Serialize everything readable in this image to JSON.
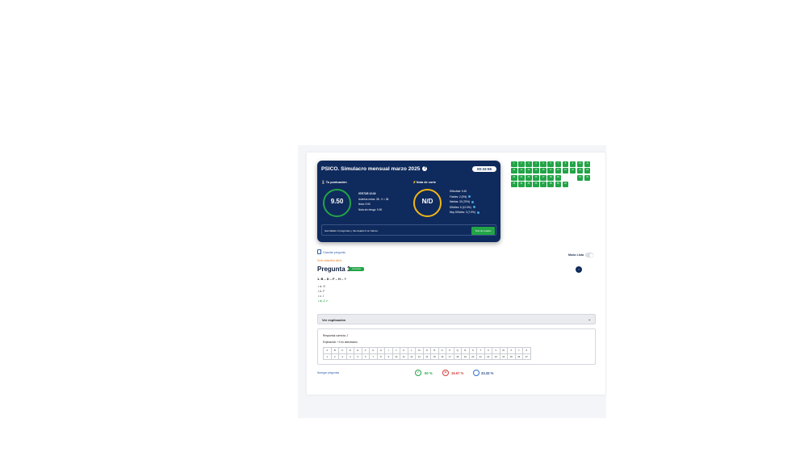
{
  "summary": {
    "title": "PSICO. Simulacro mensual marzo 2025",
    "timer": "00:33:55",
    "score_label": "Tu puntuación",
    "score_value": "9.50",
    "stats": {
      "date": "07/07/25 12:16",
      "aciertos": "Aciertos netos: 38 - 0 = 38",
      "nota": "Nota: 9.50",
      "nota_sin_riesgo": "Nota sin riesgo: 9.50"
    },
    "cut_label": "Nota de corte",
    "cut_value": "N/D",
    "difficulty": {
      "overall": "Dificultad: 5.45",
      "faciles": "Fáciles: 2 (5%)",
      "medias": "Medias: 30 (75%)",
      "dificiles": "Difíciles: 5 (12.5%)",
      "muy_dificiles": "Muy Difíciles: 3 (7.5%)"
    },
    "message": "Has fallado 0 preguntas y has dejado 0 en blanco.",
    "repaso_button": "Test de repaso"
  },
  "grid": {
    "cells": [
      "1",
      "2",
      "3",
      "4",
      "5",
      "6",
      "7",
      "8",
      "9",
      "10",
      "11",
      "12",
      "13",
      "14",
      "15",
      "16",
      "17",
      "18",
      "19",
      "20",
      "21",
      "22",
      "23",
      "24",
      "25",
      "26",
      "27",
      "28",
      "29",
      "...",
      "",
      "31",
      "32",
      "33",
      "34",
      "35",
      "36",
      "37",
      "38",
      "39",
      "40"
    ]
  },
  "question": {
    "save_link": "Guardar pregunta",
    "category": "Serie alfabética difícil",
    "modo_lista": "Modo Lista",
    "title": "Pregunta 1",
    "badge": "Correcta",
    "next": "›",
    "statement": "1. B – D – F – H – ?",
    "options": [
      "a. G",
      "b. F",
      "c. I",
      "d. J"
    ],
    "check": "✓",
    "explanation_toggle": "Ver explicación",
    "chevron": "⌄",
    "answer_line": "Respuesta correcta: J",
    "explanation_line": "Explicación: +2 en abecedario.",
    "letters": [
      "A",
      "B",
      "C",
      "D",
      "E",
      "F",
      "G",
      "H",
      "I",
      "J",
      "K",
      "L",
      "M",
      "N",
      "Ñ",
      "O",
      "P",
      "Q",
      "R",
      "S",
      "T",
      "U",
      "V",
      "W",
      "X",
      "Y",
      "Z"
    ],
    "numbers": [
      "1",
      "2",
      "3",
      "4",
      "5",
      "6",
      "7",
      "8",
      "9",
      "10",
      "11",
      "12",
      "13",
      "14",
      "15",
      "16",
      "17",
      "18",
      "19",
      "20",
      "21",
      "22",
      "23",
      "24",
      "25",
      "26",
      "27"
    ],
    "nav_link": "Navegar preguntas"
  },
  "results": {
    "correct": "50 %",
    "wrong": "16.67 %",
    "blank": "33.33 %",
    "ok_icon": "✓",
    "bad_icon": "✕"
  },
  "colors": {
    "panel": "#0f2a5c",
    "green": "#22a447",
    "yellow": "#f2b617",
    "red": "#d93a3a",
    "blue": "#2f6ec9"
  }
}
